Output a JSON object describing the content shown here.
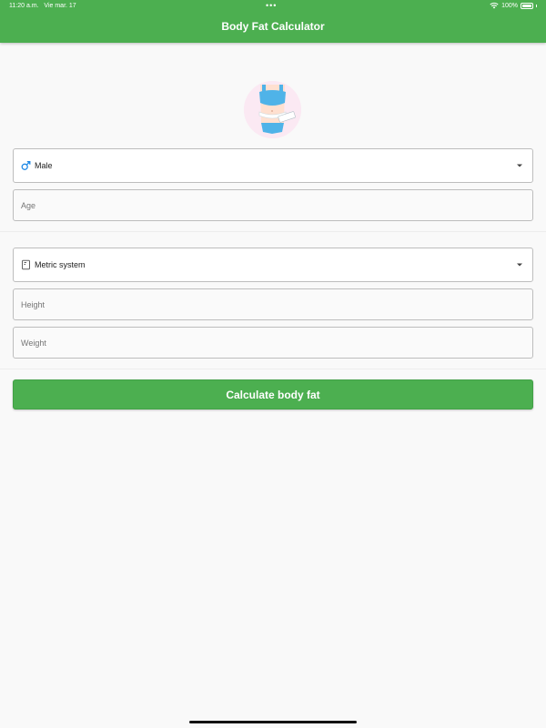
{
  "status_bar": {
    "time": "11:20 a.m.",
    "date": "Vie mar. 17",
    "battery": "100%"
  },
  "app": {
    "title": "Body Fat Calculator"
  },
  "colors": {
    "primary": "#4caf50",
    "male_icon": "#1e88e5"
  },
  "form": {
    "gender": {
      "selected": "Male",
      "icon": "male-symbol-icon"
    },
    "age": {
      "placeholder": "Age"
    },
    "unit_system": {
      "selected": "Metric system",
      "icon": "ruler-icon"
    },
    "height": {
      "placeholder": "Height"
    },
    "weight": {
      "placeholder": "Weight"
    }
  },
  "actions": {
    "calculate_label": "Calculate body fat"
  }
}
